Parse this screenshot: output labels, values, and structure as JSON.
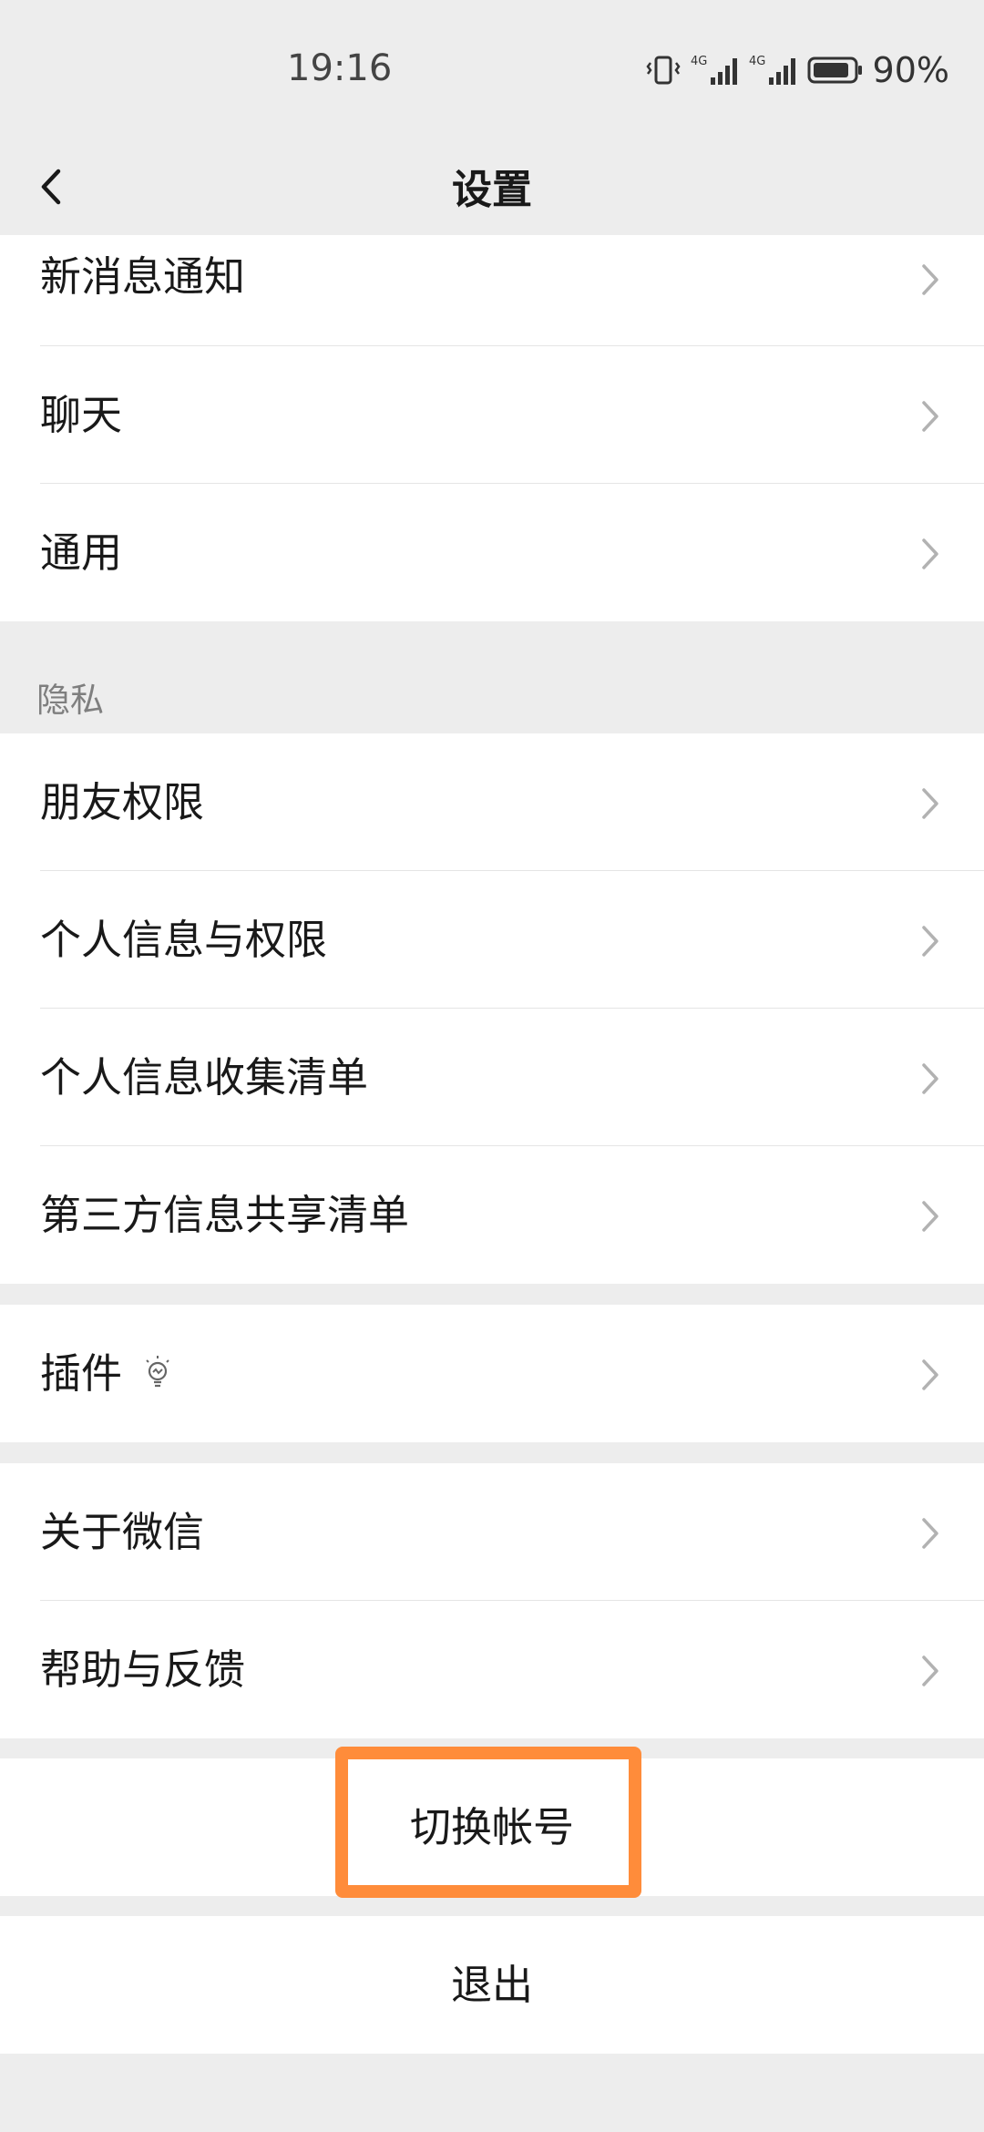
{
  "status_bar": {
    "time": "19:16",
    "network_1": "4G",
    "network_2": "4G",
    "battery_percent": "90%",
    "battery_level": 0.9
  },
  "nav": {
    "title": "设置"
  },
  "group_top": {
    "items": [
      {
        "label": "新消息通知"
      },
      {
        "label": "聊天"
      },
      {
        "label": "通用"
      }
    ]
  },
  "privacy": {
    "header": "隐私",
    "items": [
      {
        "label": "朋友权限"
      },
      {
        "label": "个人信息与权限"
      },
      {
        "label": "个人信息收集清单"
      },
      {
        "label": "第三方信息共享清单"
      }
    ]
  },
  "plugins": {
    "label": "插件"
  },
  "about": {
    "items": [
      {
        "label": "关于微信"
      },
      {
        "label": "帮助与反馈"
      }
    ]
  },
  "actions": {
    "switch_account": "切换帐号",
    "logout": "退出"
  },
  "colors": {
    "background": "#ededed",
    "card": "#ffffff",
    "highlight": "#ff8c3a",
    "chevron": "#b2b2b2"
  }
}
